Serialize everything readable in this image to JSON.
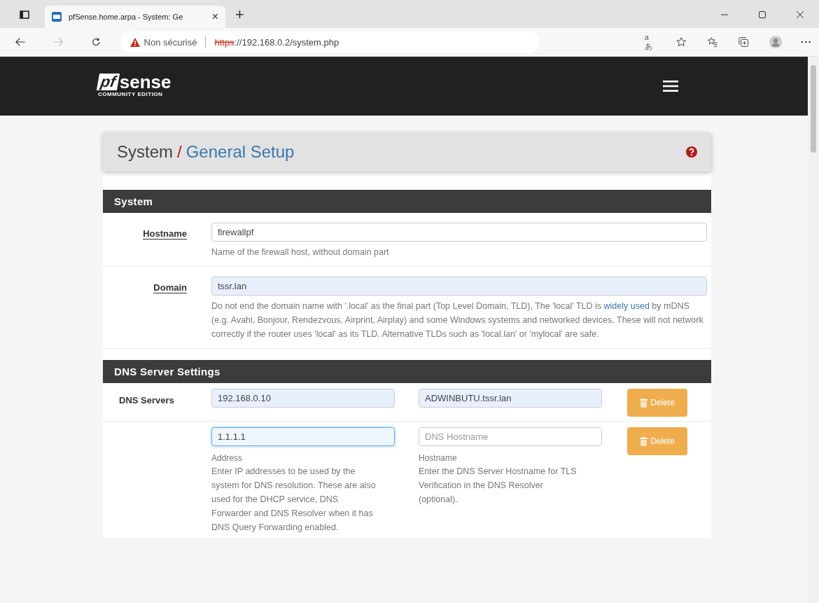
{
  "browser": {
    "tab_title": "pfSense.home.arpa - System: Ge",
    "tab_close": "×",
    "new_tab": "+",
    "security_label": "Non sécurisé",
    "url_scheme": "https",
    "url_rest": "://192.168.0.2/system.php",
    "read_aloud": "aあ"
  },
  "navbar": {
    "logo_mark": "pf",
    "logo_word": "sense",
    "logo_sub": "COMMUNITY EDITION"
  },
  "breadcrumb": {
    "parent": "System",
    "separator": "/",
    "current": "General Setup"
  },
  "system_panel": {
    "title": "System",
    "rows": [
      {
        "label": "Hostname",
        "value": "firewallpf",
        "autofilled": false,
        "help": [
          {
            "text": "Name of the firewall host, without domain part",
            "link": false
          }
        ]
      },
      {
        "label": "Domain",
        "value": "tssr.lan",
        "autofilled": true,
        "help": [
          {
            "text": "Do not end the domain name with '.local' as the final part (Top Level Domain, TLD), The 'local' TLD is ",
            "link": false
          },
          {
            "text": "widely used",
            "link": true
          },
          {
            "text": " by mDNS (e.g. Avahi, Bonjour, Rendezvous, Airprint, Airplay) and some Windows systems and networked devices. These will not network correctly if the router uses 'local' as its TLD. Alternative TLDs such as 'local.lan' or 'mylocal' are safe.",
            "link": false
          }
        ]
      }
    ]
  },
  "dns_panel": {
    "title": "DNS Server Settings",
    "label": "DNS Servers",
    "servers": [
      {
        "address": "192.168.0.10",
        "address_autofilled": true,
        "address_focused": false,
        "hostname": "ADWINBUTU.tssr.lan",
        "hostname_autofilled": true,
        "delete": "Delete"
      },
      {
        "address": "1.1.1.1",
        "address_autofilled": false,
        "address_focused": true,
        "hostname_placeholder": "DNS Hostname",
        "hostname_autofilled": false,
        "delete": "Delete"
      }
    ],
    "address_caption": "Address",
    "address_help": "Enter IP addresses to be used by the system for DNS resolution. These are also used for the DHCP service, DNS Forwarder and DNS Resolver when it has DNS Query Forwarding enabled.",
    "hostname_caption": "Hostname",
    "hostname_help": "Enter the DNS Server Hostname for TLS Verification in the DNS Resolver (optional)."
  }
}
